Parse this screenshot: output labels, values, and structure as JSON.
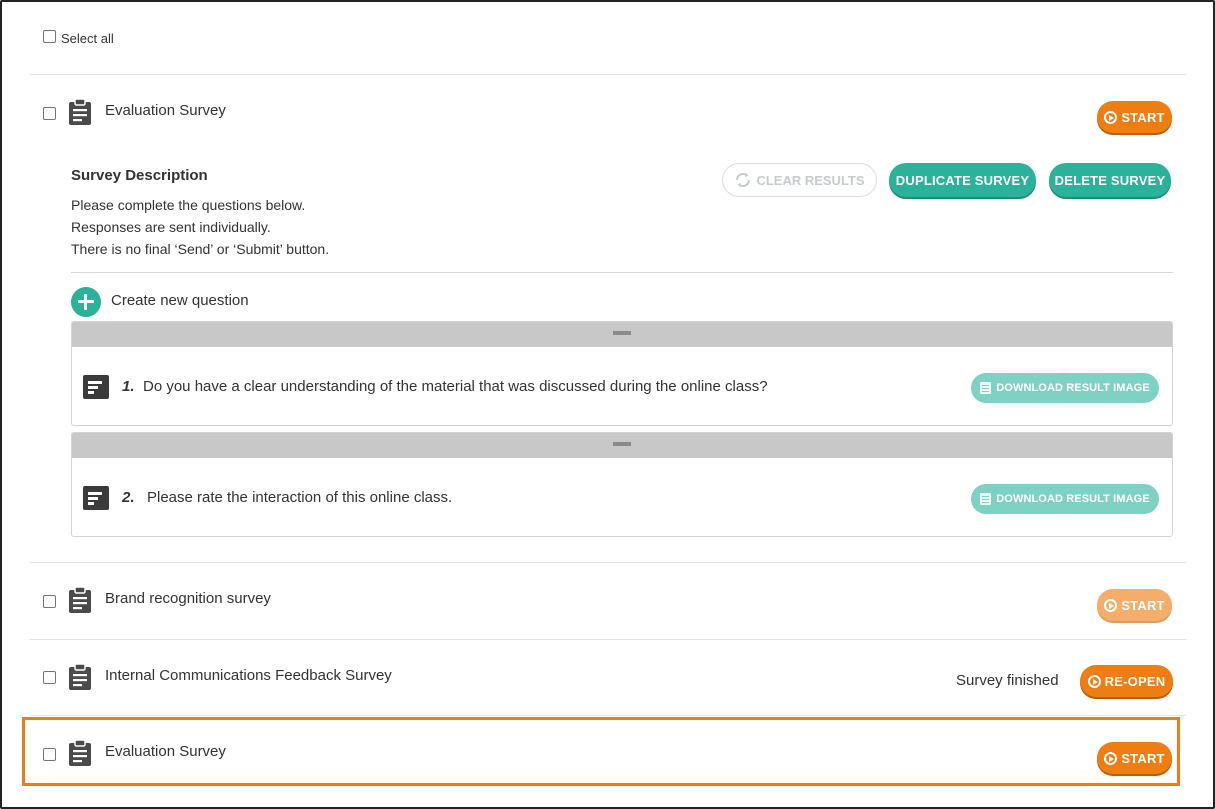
{
  "header": {
    "select_all_label": "Select all"
  },
  "buttons": {
    "start": "START",
    "reopen": "RE-OPEN",
    "clear_results": "CLEAR RESULTS",
    "duplicate_survey": "DUPLICATE SURVEY",
    "delete_survey": "DELETE SURVEY",
    "download_result_image": "DOWNLOAD RESULT IMAGE"
  },
  "expanded_survey": {
    "title": "Evaluation Survey",
    "description_heading": "Survey Description",
    "description_lines": [
      "Please complete the questions below.",
      "Responses are sent individually.",
      "There is no final ‘Send’ or ‘Submit’ button."
    ],
    "create_question_label": "Create new question",
    "questions": [
      {
        "number": "1.",
        "text": "Do you have a clear understanding of the material that was discussed during the online class?"
      },
      {
        "number": "2.",
        "text": "Please rate the interaction of this online class."
      }
    ]
  },
  "surveys": [
    {
      "title": "Brand recognition survey",
      "status": ""
    },
    {
      "title": "Internal Communications Feedback Survey",
      "status": "Survey finished"
    },
    {
      "title": "Evaluation Survey",
      "status": ""
    }
  ],
  "colors": {
    "accent_orange": "#ee7d13",
    "accent_teal": "#2bb29a",
    "highlight_border": "#ee7d13"
  },
  "icons": {
    "survey": "clipboard-icon",
    "question": "text-lines-icon",
    "start": "play-circle-icon",
    "clear": "refresh-icon",
    "create": "plus-circle-icon",
    "download": "document-icon",
    "drag": "drag-handle-icon"
  }
}
